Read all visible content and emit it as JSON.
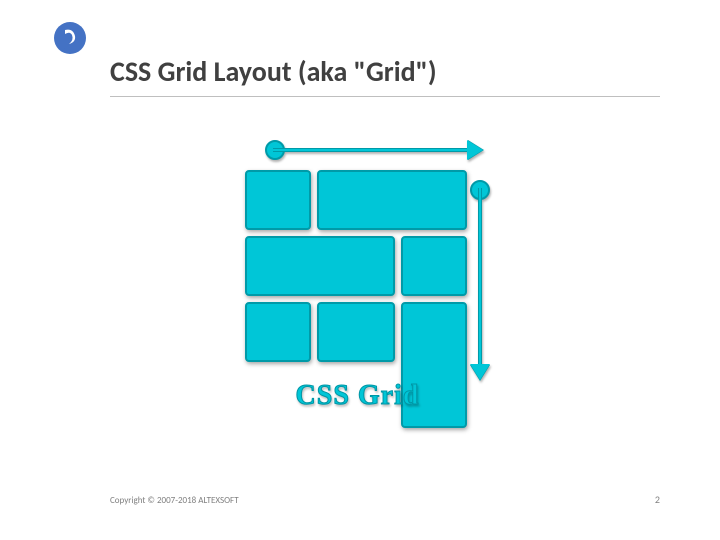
{
  "title": "CSS Grid Layout (aka \"Grid\")",
  "illustration": {
    "caption": "CSS Grid"
  },
  "footer": {
    "copyright": "Copyright © 2007-2018 ALTEXSOFT"
  },
  "page_number": "2",
  "brand": {
    "accent": "#00c6d7",
    "logo_bg": "#4472c4"
  }
}
